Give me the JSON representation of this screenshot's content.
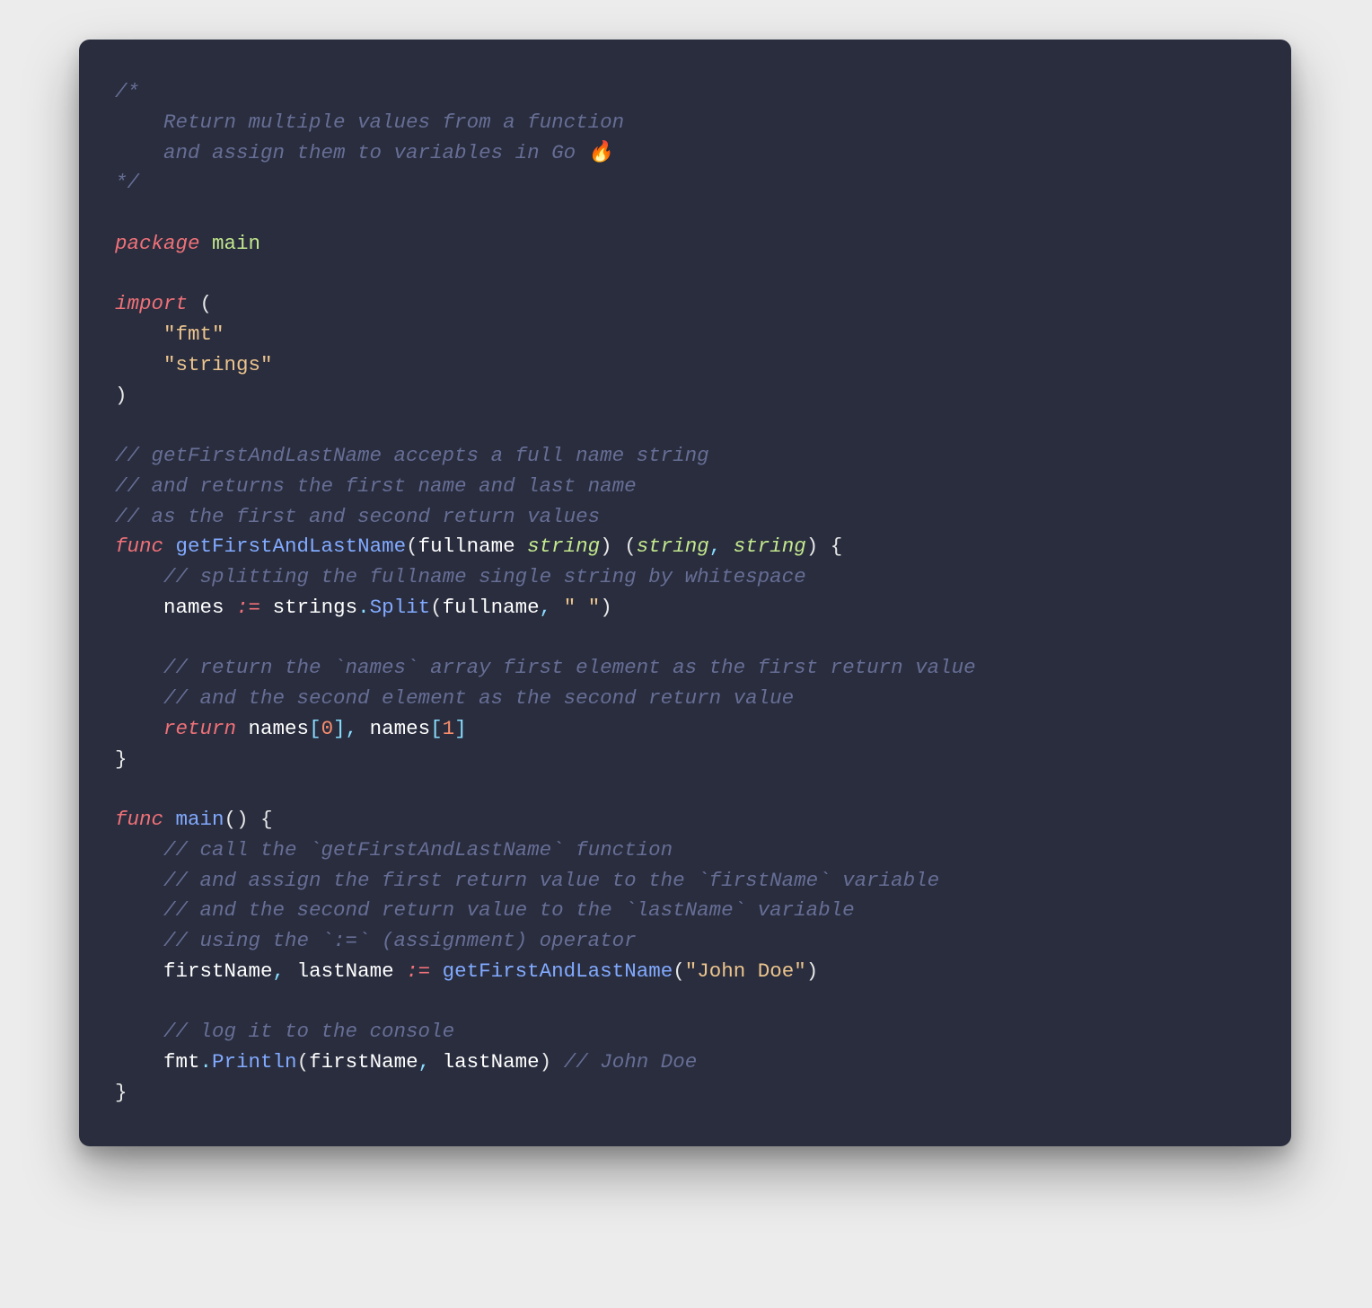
{
  "code": {
    "c1": "/*",
    "c2": "    Return multiple values from a function",
    "c3": "    and assign them to variables in Go 🔥",
    "c4": "*/",
    "kw_package": "package",
    "id_main": "main",
    "kw_import": "import",
    "paren_open": "(",
    "paren_close": ")",
    "brace_open": "{",
    "brace_close": "}",
    "str_fmt": "\"fmt\"",
    "str_strings": "\"strings\"",
    "c5": "// getFirstAndLastName accepts a full name string",
    "c6": "// and returns the first name and last name",
    "c7": "// as the first and second return values",
    "kw_func": "func",
    "fn_getFirstAndLastName": "getFirstAndLastName",
    "id_fullname": "fullname",
    "type_string": "string",
    "comma": ",",
    "c8": "// splitting the fullname single string by whitespace",
    "id_names": "names",
    "op_assign": ":=",
    "id_strings": "strings",
    "dot": ".",
    "id_Split": "Split",
    "str_space": "\" \"",
    "c9": "// return the `names` array first element as the first return value",
    "c10": "// and the second element as the second return value",
    "kw_return": "return",
    "bracket_open": "[",
    "bracket_close": "]",
    "num_0": "0",
    "num_1": "1",
    "fn_main": "main",
    "c11": "// call the `getFirstAndLastName` function",
    "c12": "// and assign the first return value to the `firstName` variable",
    "c13": "// and the second return value to the `lastName` variable",
    "c14": "// using the `:=` (assignment) operator",
    "id_firstName": "firstName",
    "id_lastName": "lastName",
    "str_johndoe": "\"John Doe\"",
    "c15": "// log it to the console",
    "id_fmt": "fmt",
    "id_Println": "Println",
    "c16": "// John Doe"
  }
}
